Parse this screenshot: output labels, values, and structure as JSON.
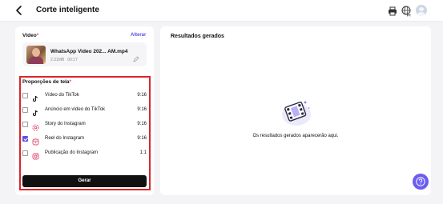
{
  "header": {
    "back_icon": "chevron-left-icon",
    "title": "Corte inteligente",
    "icons": [
      "printer-icon",
      "globe-language-icon",
      "avatar"
    ],
    "language": "PT"
  },
  "video_section": {
    "label": "Vídeo",
    "required_mark": "*",
    "change_link": "Alterar",
    "file_name": "WhatsApp Video 202...  AM.mp4",
    "file_size": "2.31MB",
    "duration": "00:17"
  },
  "ratio_section": {
    "label": "Proporções de tela",
    "required_mark": "*",
    "items": [
      {
        "label": "Vídeo do TikTok",
        "ratio": "9:16",
        "checked": false,
        "icon": "tiktok-icon"
      },
      {
        "label": "Anúncio em vídeo do TikTok",
        "ratio": "9:16",
        "checked": false,
        "icon": "tiktok-icon"
      },
      {
        "label": "Story do Instagram",
        "ratio": "9:16",
        "checked": false,
        "icon": "instagram-story-icon"
      },
      {
        "label": "Reel do Instagram",
        "ratio": "9:16",
        "checked": true,
        "icon": "instagram-reel-icon"
      },
      {
        "label": "Publicação do Instagram",
        "ratio": "1:1",
        "checked": false,
        "icon": "instagram-icon"
      }
    ]
  },
  "generate_button": "Gerar",
  "results": {
    "title": "Resultados gerados",
    "empty_message": "Os resultados gerados aparecerão aqui."
  },
  "colors": {
    "accent": "#5b4fe0",
    "highlight_border": "#d9262c",
    "button_bg": "#111111"
  }
}
